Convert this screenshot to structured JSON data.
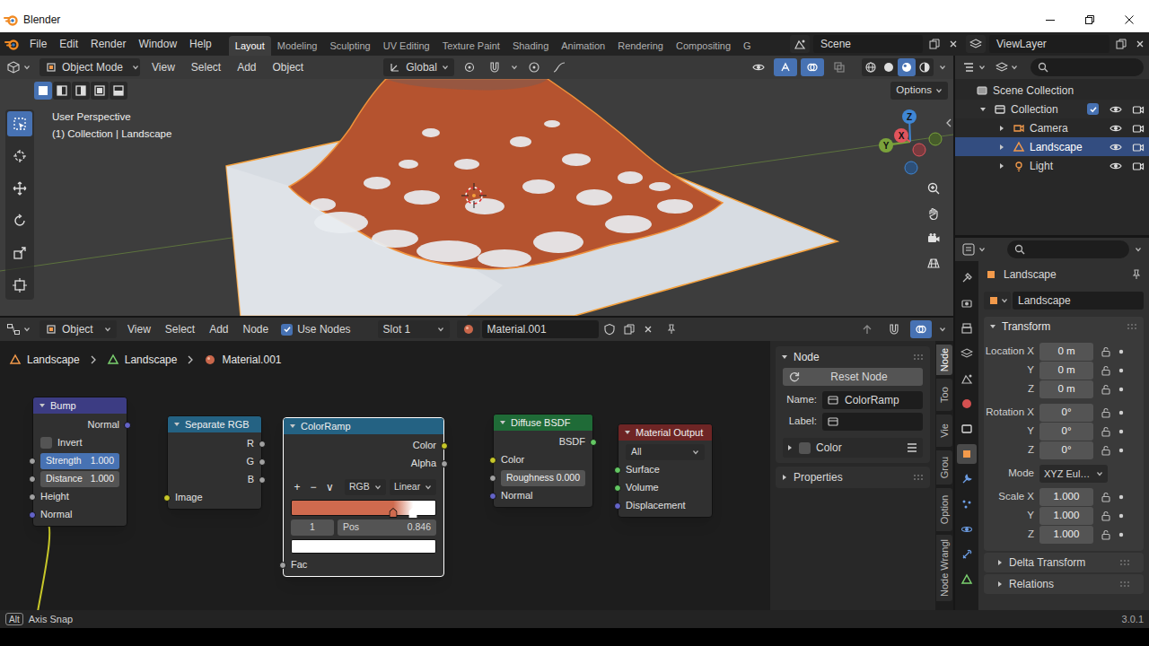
{
  "window": {
    "title": "Blender"
  },
  "topbar": {
    "menus": [
      "File",
      "Edit",
      "Render",
      "Window",
      "Help"
    ],
    "workspaces": [
      {
        "label": "Layout",
        "selected": true
      },
      {
        "label": "Modeling",
        "selected": false
      },
      {
        "label": "Sculpting",
        "selected": false
      },
      {
        "label": "UV Editing",
        "selected": false
      },
      {
        "label": "Texture Paint",
        "selected": false
      },
      {
        "label": "Shading",
        "selected": false
      },
      {
        "label": "Animation",
        "selected": false
      },
      {
        "label": "Rendering",
        "selected": false
      },
      {
        "label": "Compositing",
        "selected": false
      },
      {
        "label": "G",
        "selected": false
      }
    ],
    "scene": "Scene",
    "view_layer": "ViewLayer"
  },
  "viewport": {
    "mode": "Object Mode",
    "menus": [
      "View",
      "Select",
      "Add",
      "Object"
    ],
    "orientation": "Global",
    "header_toggles": [
      {
        "selected": false
      },
      {
        "selected": true
      },
      {
        "selected": true
      },
      {
        "selected": false
      }
    ],
    "shading": [
      {
        "selected": false
      },
      {
        "selected": false
      },
      {
        "selected": true
      },
      {
        "selected": false
      }
    ],
    "select_modes": [
      {
        "selected": true
      },
      {
        "selected": false
      },
      {
        "selected": false
      },
      {
        "selected": false
      },
      {
        "selected": false
      }
    ],
    "tools": [
      {
        "selected": true
      },
      {
        "selected": false
      },
      {
        "selected": false
      },
      {
        "selected": false
      },
      {
        "selected": false
      },
      {
        "selected": false
      }
    ],
    "info": [
      "User Perspective",
      "(1) Collection | Landscape"
    ],
    "options": "Options",
    "axes": [
      "X",
      "Y",
      "Z"
    ]
  },
  "outliner": {
    "items": [
      {
        "label": "Scene Collection",
        "kind": "scene",
        "selected": false
      },
      {
        "label": "Collection",
        "kind": "collection",
        "expanded": true,
        "selected": false,
        "checked": true,
        "visible": true
      },
      {
        "label": "Camera",
        "kind": "camera",
        "expanded": false,
        "selected": false,
        "visible": true
      },
      {
        "label": "Landscape",
        "kind": "mesh",
        "expanded": false,
        "selected": true,
        "visible": true
      },
      {
        "label": "Light",
        "kind": "light",
        "expanded": false,
        "selected": false,
        "visible": true
      }
    ]
  },
  "properties": {
    "tabs": [
      {
        "selected": false
      },
      {
        "selected": false
      },
      {
        "selected": false
      },
      {
        "selected": false
      },
      {
        "selected": false
      },
      {
        "selected": false
      },
      {
        "selected": false
      },
      {
        "selected": true
      },
      {
        "selected": false
      },
      {
        "selected": false
      },
      {
        "selected": false
      },
      {
        "selected": false
      },
      {
        "selected": false
      }
    ],
    "object": "Landscape",
    "data": "Landscape",
    "transform": {
      "title": "Transform",
      "expanded": true,
      "rows": [
        {
          "label": "Location X",
          "value": "0 m",
          "kind": "field",
          "locked": false
        },
        {
          "label": "Y",
          "value": "0 m",
          "kind": "field",
          "locked": false
        },
        {
          "label": "Z",
          "value": "0 m",
          "kind": "field",
          "locked": false
        },
        {
          "label": "Rotation X",
          "value": "0°",
          "kind": "field",
          "locked": false
        },
        {
          "label": "Y",
          "value": "0°",
          "kind": "field",
          "locked": false
        },
        {
          "label": "Z",
          "value": "0°",
          "kind": "field",
          "locked": false
        },
        {
          "label": "Mode",
          "value": "XYZ Eul…",
          "kind": "dropdown"
        },
        {
          "label": "Scale X",
          "value": "1.000",
          "kind": "field",
          "locked": false
        },
        {
          "label": "Y",
          "value": "1.000",
          "kind": "field",
          "locked": false
        },
        {
          "label": "Z",
          "value": "1.000",
          "kind": "field",
          "locked": false
        }
      ]
    },
    "subpanels": [
      {
        "title": "Delta Transform",
        "expanded": false
      },
      {
        "title": "Relations",
        "expanded": false
      }
    ]
  },
  "node_editor": {
    "type": "Object",
    "menus": [
      "View",
      "Select",
      "Add",
      "Node"
    ],
    "use_nodes": {
      "label": "Use Nodes",
      "checked": true
    },
    "slot": "Slot 1",
    "material": "Material.001",
    "header_toggles": [
      {
        "selected": false
      },
      {
        "selected": false
      },
      {
        "selected": true
      }
    ],
    "breadcrumb": [
      "Landscape",
      "Landscape",
      "Material.001"
    ],
    "nodes": [
      {
        "title": "Bump",
        "kind": "vector",
        "selected": false,
        "rows": [
          {
            "kind": "output",
            "label": "Normal",
            "socket": "vector"
          },
          {
            "kind": "checkbox",
            "label": "Invert",
            "checked": false
          },
          {
            "kind": "slider",
            "label": "Strength",
            "value": "1.000",
            "level": 1,
            "socket": "float"
          },
          {
            "kind": "field",
            "label": "Distance",
            "value": "1.000",
            "socket": "float"
          },
          {
            "kind": "input",
            "label": "Height",
            "socket": "float"
          },
          {
            "kind": "input",
            "label": "Normal",
            "socket": "vector"
          }
        ]
      },
      {
        "title": "Separate RGB",
        "kind": "converter",
        "selected": false,
        "rows": [
          {
            "kind": "output",
            "label": "R",
            "socket": "float"
          },
          {
            "kind": "output",
            "label": "G",
            "socket": "float"
          },
          {
            "kind": "output",
            "label": "B",
            "socket": "float"
          },
          {
            "kind": "input",
            "label": "Image",
            "socket": "color"
          }
        ]
      },
      {
        "title": "ColorRamp",
        "kind": "converter",
        "selected": true,
        "rows": [
          {
            "kind": "output",
            "label": "Color",
            "socket": "color"
          },
          {
            "kind": "output",
            "label": "Alpha",
            "socket": "float"
          },
          {
            "kind": "ramp",
            "buttons": [
              "+",
              "−",
              "∨"
            ],
            "color_mode": "RGB",
            "interpolation": "Linear",
            "stops": [
              {
                "position": 0.707,
                "color": "#cf6a4e",
                "selected": false
              },
              {
                "position": 0.846,
                "color": "#ffffff",
                "selected": true
              }
            ],
            "index": "1",
            "pos_label": "Pos",
            "pos": "0.846",
            "swatch": "#ffffff"
          },
          {
            "kind": "input",
            "label": "Fac",
            "socket": "float"
          }
        ]
      },
      {
        "title": "Diffuse BSDF",
        "kind": "shader",
        "selected": false,
        "rows": [
          {
            "kind": "output",
            "label": "BSDF",
            "socket": "shader"
          },
          {
            "kind": "input",
            "label": "Color",
            "socket": "color"
          },
          {
            "kind": "field",
            "label": "Roughness",
            "value": "0.000",
            "socket": "float"
          },
          {
            "kind": "input",
            "label": "Normal",
            "socket": "vector"
          }
        ]
      },
      {
        "title": "Material Output",
        "kind": "output",
        "selected": false,
        "rows": [
          {
            "kind": "dropdown",
            "value": "All"
          },
          {
            "kind": "input",
            "label": "Surface",
            "socket": "shader"
          },
          {
            "kind": "input",
            "label": "Volume",
            "socket": "shader"
          },
          {
            "kind": "input",
            "label": "Displacement",
            "socket": "vector"
          }
        ]
      }
    ],
    "links": [
      {
        "from": [
          0,
          0
        ],
        "to": [
          1,
          3
        ]
      },
      {
        "from": [
          1,
          2
        ],
        "to": [
          2,
          3
        ]
      },
      {
        "from": [
          2,
          0
        ],
        "to": [
          3,
          1
        ]
      },
      {
        "from": [
          3,
          0
        ],
        "to": [
          4,
          1
        ]
      }
    ],
    "sidebar": {
      "panel": "Node",
      "reset": "Reset Node",
      "name_label": "Name:",
      "name": "ColorRamp",
      "label_label": "Label:",
      "color": {
        "label": "Color",
        "checked": false,
        "expanded": false
      },
      "properties": {
        "label": "Properties",
        "expanded": false
      }
    },
    "tabs": [
      {
        "label": "Node",
        "selected": true
      },
      {
        "label": "Too",
        "selected": false
      },
      {
        "label": "Vie",
        "selected": false
      },
      {
        "label": "Grou",
        "selected": false
      },
      {
        "label": "Option",
        "selected": false
      },
      {
        "label": "Node Wrangl",
        "selected": false
      }
    ]
  },
  "status_bar": {
    "key": "Alt",
    "hint": "Axis Snap",
    "version": "3.0.1"
  }
}
